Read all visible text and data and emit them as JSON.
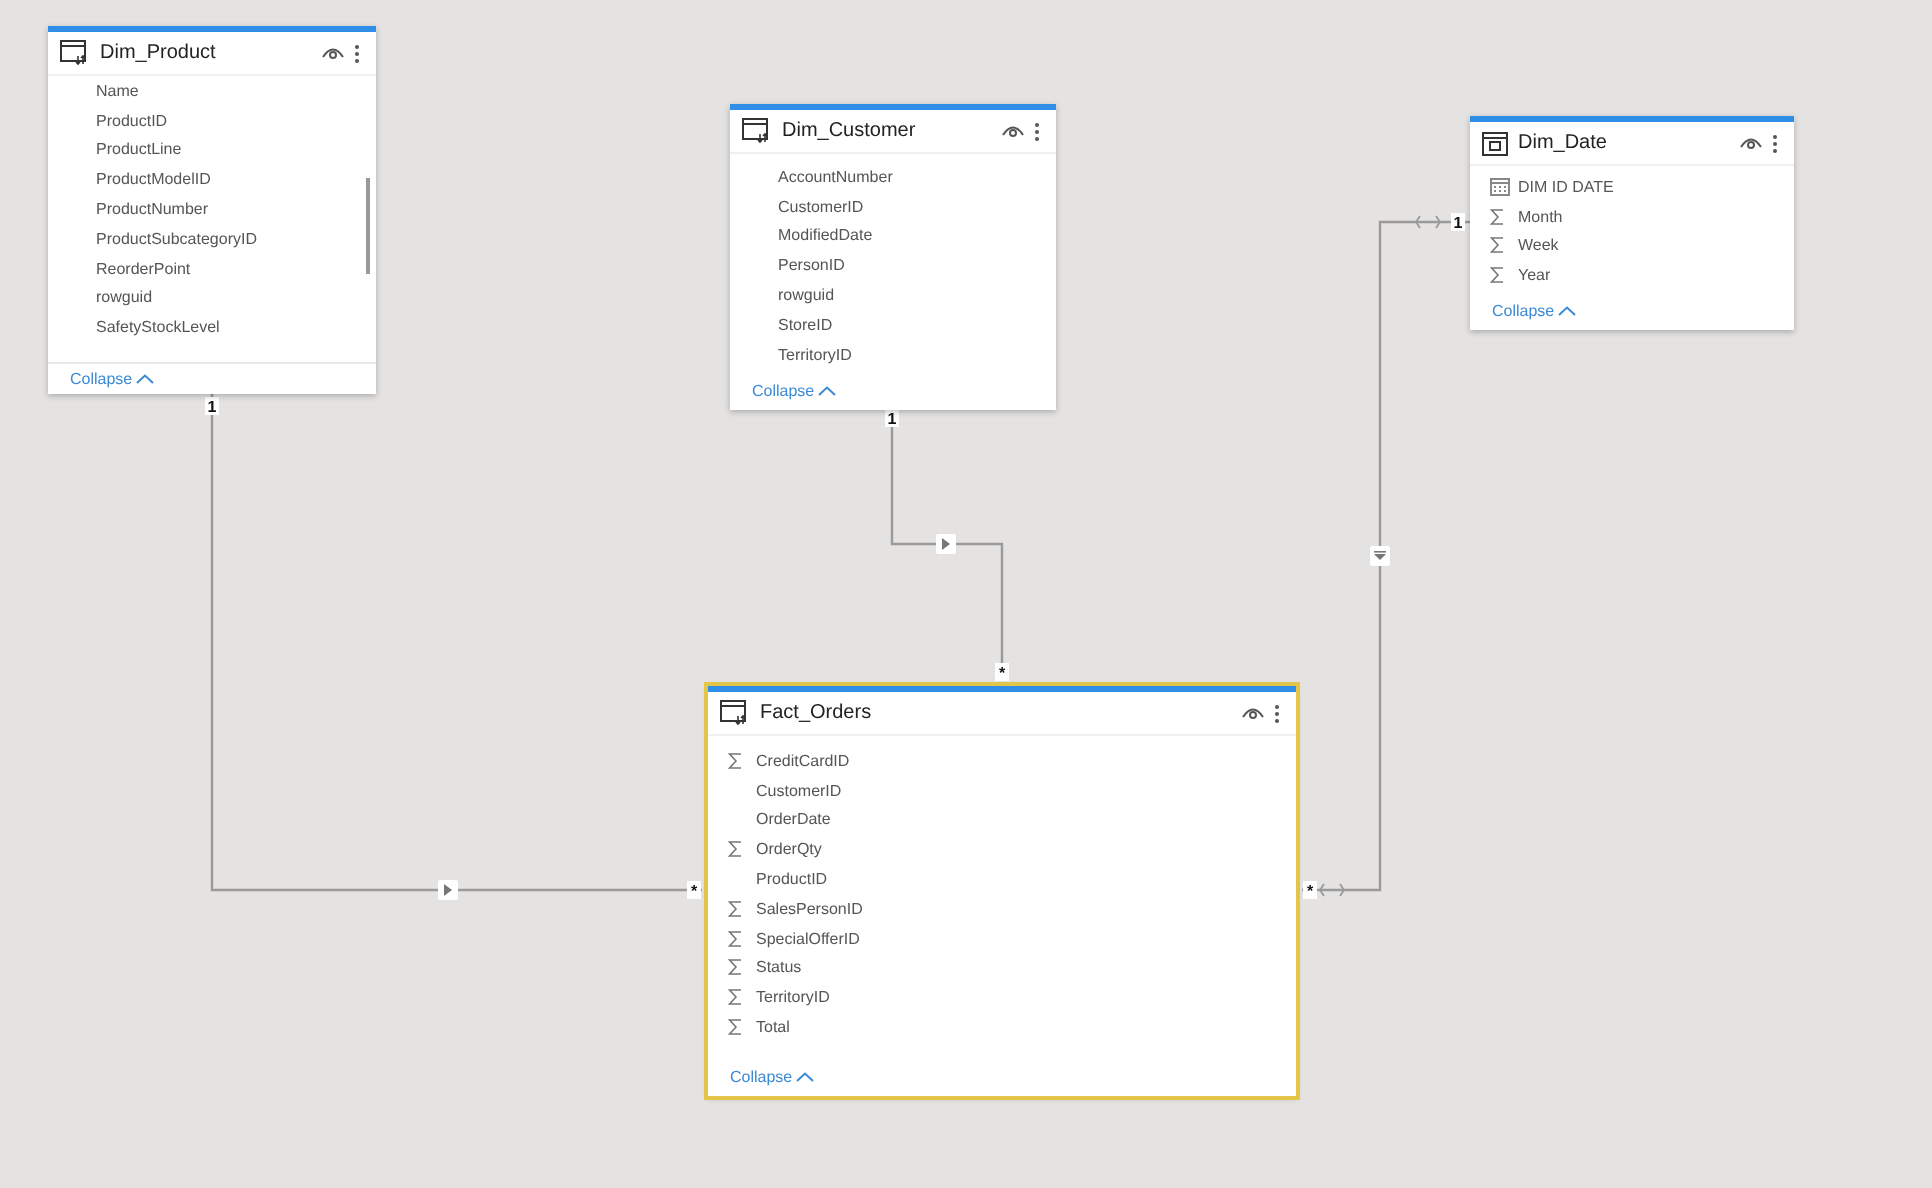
{
  "tables": [
    {
      "title": "Dim_Product",
      "selected": false,
      "fields": [
        {
          "name": "Name",
          "kind": "plain"
        },
        {
          "name": "ProductID",
          "kind": "plain"
        },
        {
          "name": "ProductLine",
          "kind": "plain"
        },
        {
          "name": "ProductModelID",
          "kind": "plain"
        },
        {
          "name": "ProductNumber",
          "kind": "plain"
        },
        {
          "name": "ProductSubcategoryID",
          "kind": "plain"
        },
        {
          "name": "ReorderPoint",
          "kind": "plain"
        },
        {
          "name": "rowguid",
          "kind": "plain"
        },
        {
          "name": "SafetyStockLevel",
          "kind": "plain"
        }
      ],
      "collapse": "Collapse"
    },
    {
      "title": "Dim_Customer",
      "selected": false,
      "fields": [
        {
          "name": "AccountNumber",
          "kind": "plain"
        },
        {
          "name": "CustomerID",
          "kind": "plain"
        },
        {
          "name": "ModifiedDate",
          "kind": "plain"
        },
        {
          "name": "PersonID",
          "kind": "plain"
        },
        {
          "name": "rowguid",
          "kind": "plain"
        },
        {
          "name": "StoreID",
          "kind": "plain"
        },
        {
          "name": "TerritoryID",
          "kind": "plain"
        }
      ],
      "collapse": "Collapse"
    },
    {
      "title": "Dim_Date",
      "selected": false,
      "fields": [
        {
          "name": "DIM ID DATE",
          "kind": "calendar"
        },
        {
          "name": "Month",
          "kind": "sigma"
        },
        {
          "name": "Week",
          "kind": "sigma"
        },
        {
          "name": "Year",
          "kind": "sigma"
        }
      ],
      "collapse": "Collapse"
    },
    {
      "title": "Fact_Orders",
      "selected": true,
      "fields": [
        {
          "name": "CreditCardID",
          "kind": "sigma"
        },
        {
          "name": "CustomerID",
          "kind": "plain"
        },
        {
          "name": "OrderDate",
          "kind": "plain"
        },
        {
          "name": "OrderQty",
          "kind": "sigma"
        },
        {
          "name": "ProductID",
          "kind": "plain"
        },
        {
          "name": "SalesPersonID",
          "kind": "sigma"
        },
        {
          "name": "SpecialOfferID",
          "kind": "sigma"
        },
        {
          "name": "Status",
          "kind": "sigma"
        },
        {
          "name": "TerritoryID",
          "kind": "sigma"
        },
        {
          "name": "Total",
          "kind": "sigma"
        }
      ],
      "collapse": "Collapse"
    }
  ],
  "relationships": [
    {
      "from_cardinality": "1",
      "to_cardinality": "*",
      "bidirectional": false
    },
    {
      "from_cardinality": "1",
      "to_cardinality": "*",
      "bidirectional": false
    },
    {
      "from_cardinality": "1",
      "to_cardinality": "*",
      "bidirectional": true
    }
  ]
}
